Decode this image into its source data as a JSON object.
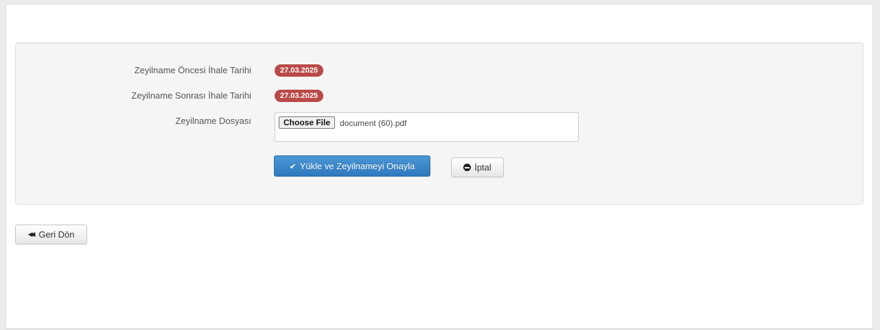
{
  "form": {
    "pre_date_label": "Zeyilname Öncesi İhale Tarihi",
    "pre_date_value": "27.03.2025",
    "post_date_label": "Zeyilname Sonrası İhale Tarihi",
    "post_date_value": "27.03.2025",
    "file_label": "Zeyilname Dosyası",
    "file_button_label": "Choose File",
    "file_name": "document (60).pdf"
  },
  "actions": {
    "upload_confirm_label": "Yükle ve Zeyilnameyi Onayla",
    "cancel_label": "İptal",
    "back_label": "Geri Dön"
  },
  "icons": {
    "upload_confirm": "check-icon",
    "cancel": "minus-circle-icon",
    "back": "backward-icon"
  },
  "colors": {
    "badge": "#b94a48",
    "primary": "#337ab7"
  }
}
